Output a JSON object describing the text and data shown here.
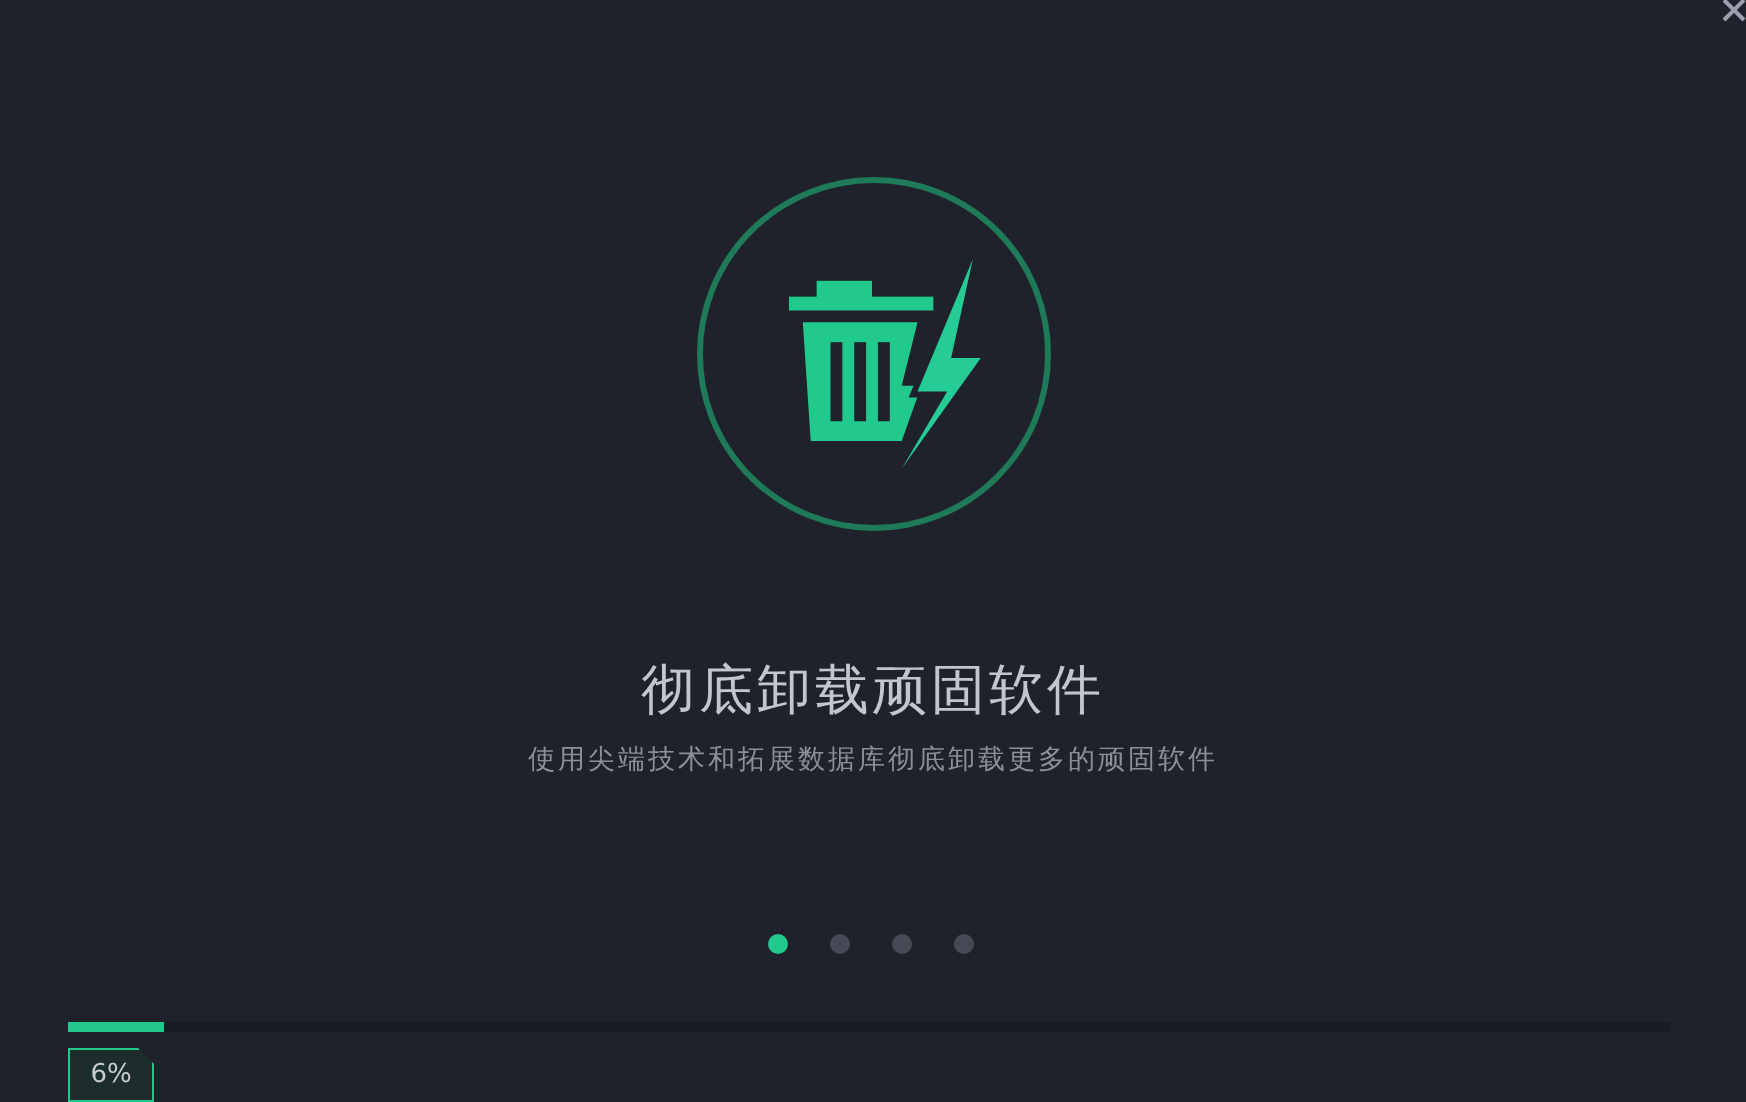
{
  "slide": {
    "title": "彻底卸载顽固软件",
    "subtitle": "使用尖端技术和拓展数据库彻底卸载更多的顽固软件"
  },
  "pager": [
    {
      "selected": true
    },
    {
      "selected": false
    },
    {
      "selected": false
    },
    {
      "selected": false
    }
  ],
  "progress": {
    "level": 0.06,
    "reading": "6%"
  }
}
